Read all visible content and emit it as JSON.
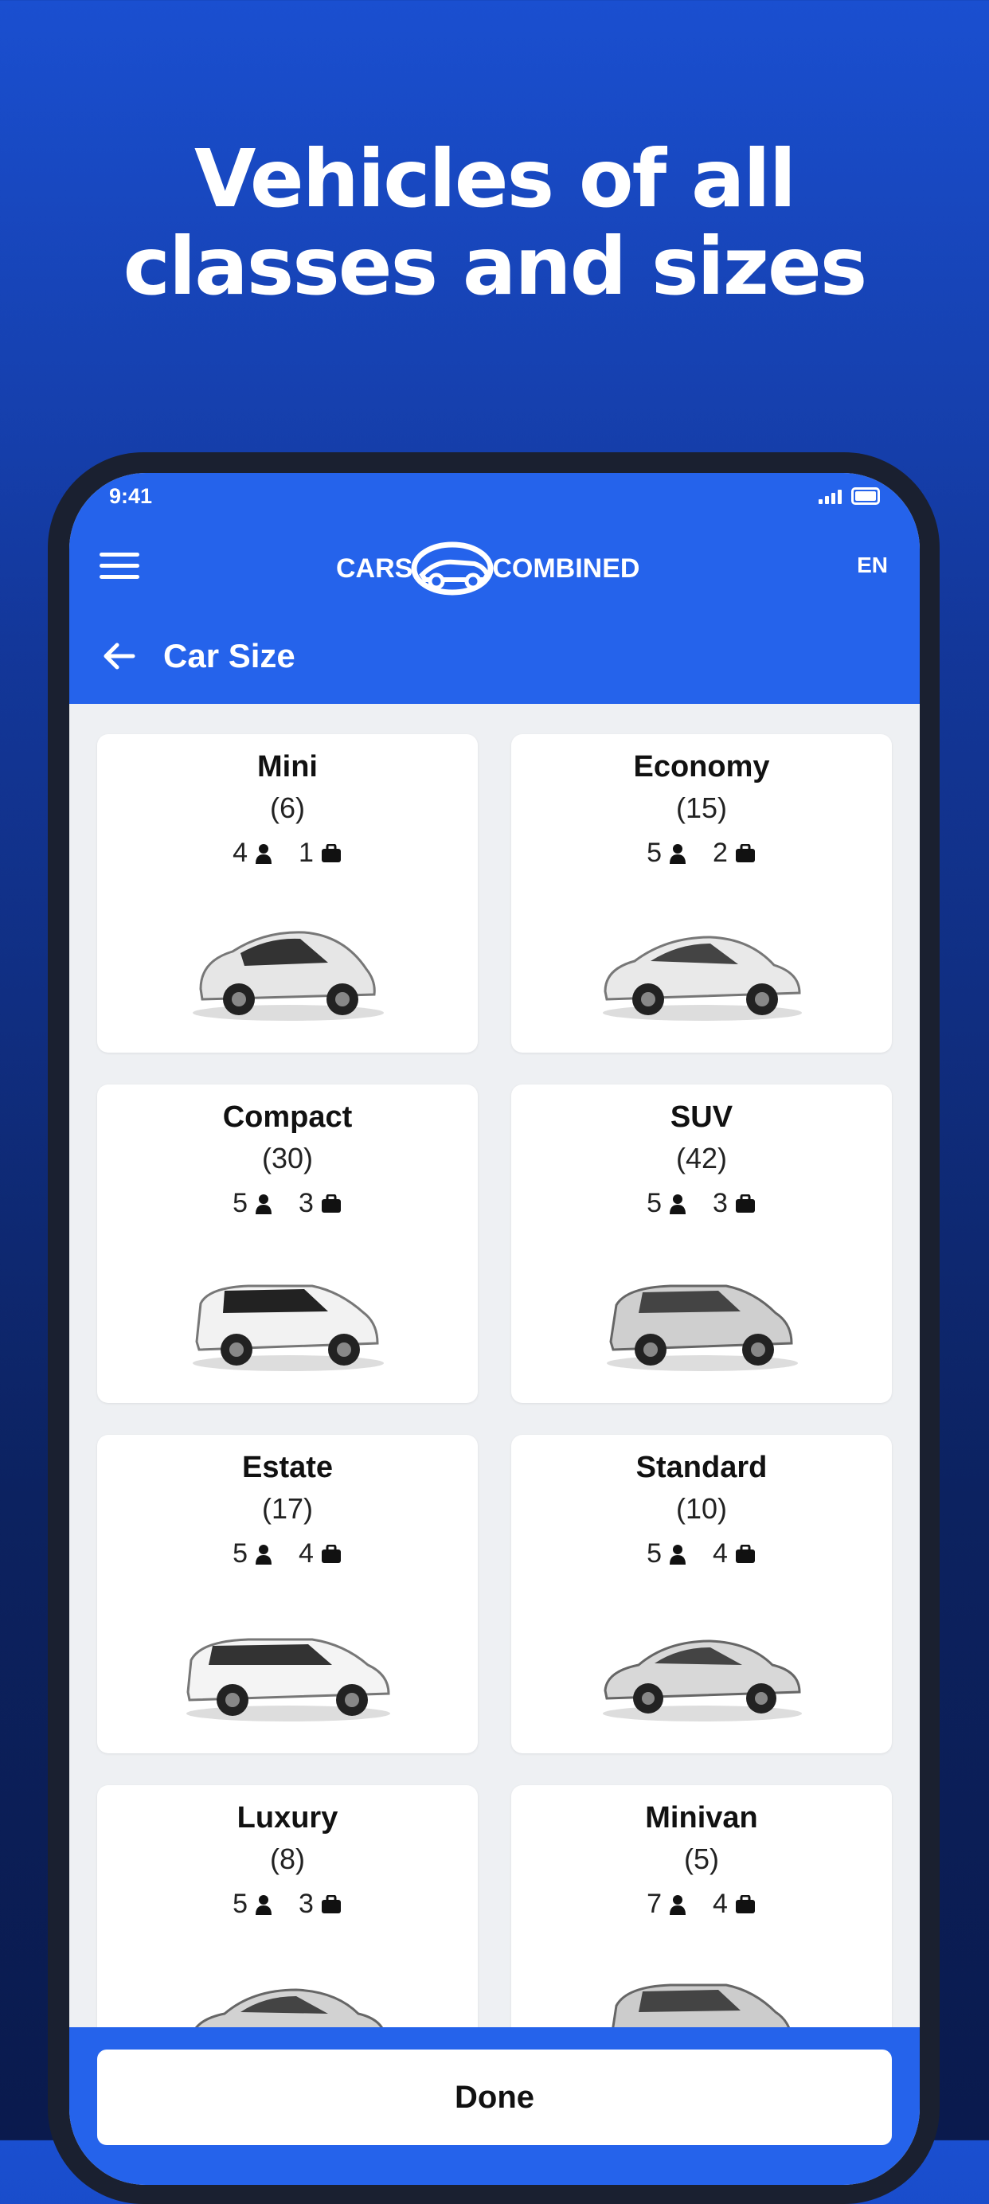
{
  "headline": {
    "line1": "Vehicles of all",
    "line2": "classes and sizes"
  },
  "status": {
    "time": "9:41"
  },
  "header": {
    "logo_left": "CARS",
    "logo_right": "COMBINED",
    "language": "EN",
    "title": "Car Size"
  },
  "cards": [
    {
      "name": "Mini",
      "count": "(6)",
      "passengers": "4",
      "bags": "1",
      "color": "#e6e6e6"
    },
    {
      "name": "Economy",
      "count": "(15)",
      "passengers": "5",
      "bags": "2",
      "color": "#e9e9e9"
    },
    {
      "name": "Compact",
      "count": "(30)",
      "passengers": "5",
      "bags": "3",
      "color": "#f2f2f2"
    },
    {
      "name": "SUV",
      "count": "(42)",
      "passengers": "5",
      "bags": "3",
      "color": "#cfcfcf"
    },
    {
      "name": "Estate",
      "count": "(17)",
      "passengers": "5",
      "bags": "4",
      "color": "#f4f4f4"
    },
    {
      "name": "Standard",
      "count": "(10)",
      "passengers": "5",
      "bags": "4",
      "color": "#d8d8d8"
    },
    {
      "name": "Luxury",
      "count": "(8)",
      "passengers": "5",
      "bags": "3",
      "color": "#d2d2d2"
    },
    {
      "name": "Minivan",
      "count": "(5)",
      "passengers": "7",
      "bags": "4",
      "color": "#cccccc"
    }
  ],
  "footer": {
    "done_label": "Done"
  },
  "colors": {
    "brand_blue": "#2563eb",
    "background_top": "#1a4fd0",
    "background_bottom": "#0a1a4d"
  }
}
